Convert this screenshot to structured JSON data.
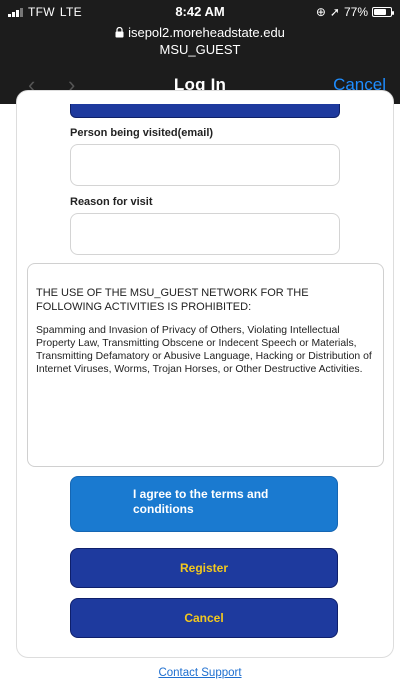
{
  "status_bar": {
    "carrier": "TFW",
    "network": "LTE",
    "time": "8:42 AM",
    "battery": "77%",
    "battery_level": 0.77
  },
  "browser": {
    "url": "isepol2.moreheadstate.edu",
    "ssid": "MSU_GUEST",
    "title": "Log In",
    "cancel_label": "Cancel",
    "back_glyph": "‹",
    "forward_glyph": "›"
  },
  "form": {
    "fields": [
      {
        "label": "Person being visited(email)",
        "value": "",
        "placeholder": ""
      },
      {
        "label": "Reason for visit",
        "value": "",
        "placeholder": ""
      }
    ],
    "terms": {
      "heading": "THE USE OF THE MSU_GUEST NETWORK FOR THE FOLLOWING ACTIVITIES IS PROHIBITED:",
      "body": "Spamming and Invasion of Privacy of Others, Violating Intellectual Property Law, Transmitting Obscene or Indecent Speech or Materials, Transmitting Defamatory or Abusive Language, Hacking or Distribution of Internet Viruses, Worms, Trojan Horses, or Other Destructive Activities."
    },
    "agree_label": "I agree to the terms and conditions",
    "register_label": "Register",
    "cancel_label": "Cancel"
  },
  "footer": {
    "contact_label": "Contact Support"
  },
  "colors": {
    "top_bar": "#1c1c1c",
    "accent_link": "#1e8dff",
    "dark_button": "#1e3a9e",
    "dark_button_text": "#f2c81e",
    "agree_button": "#1a7ad0"
  }
}
